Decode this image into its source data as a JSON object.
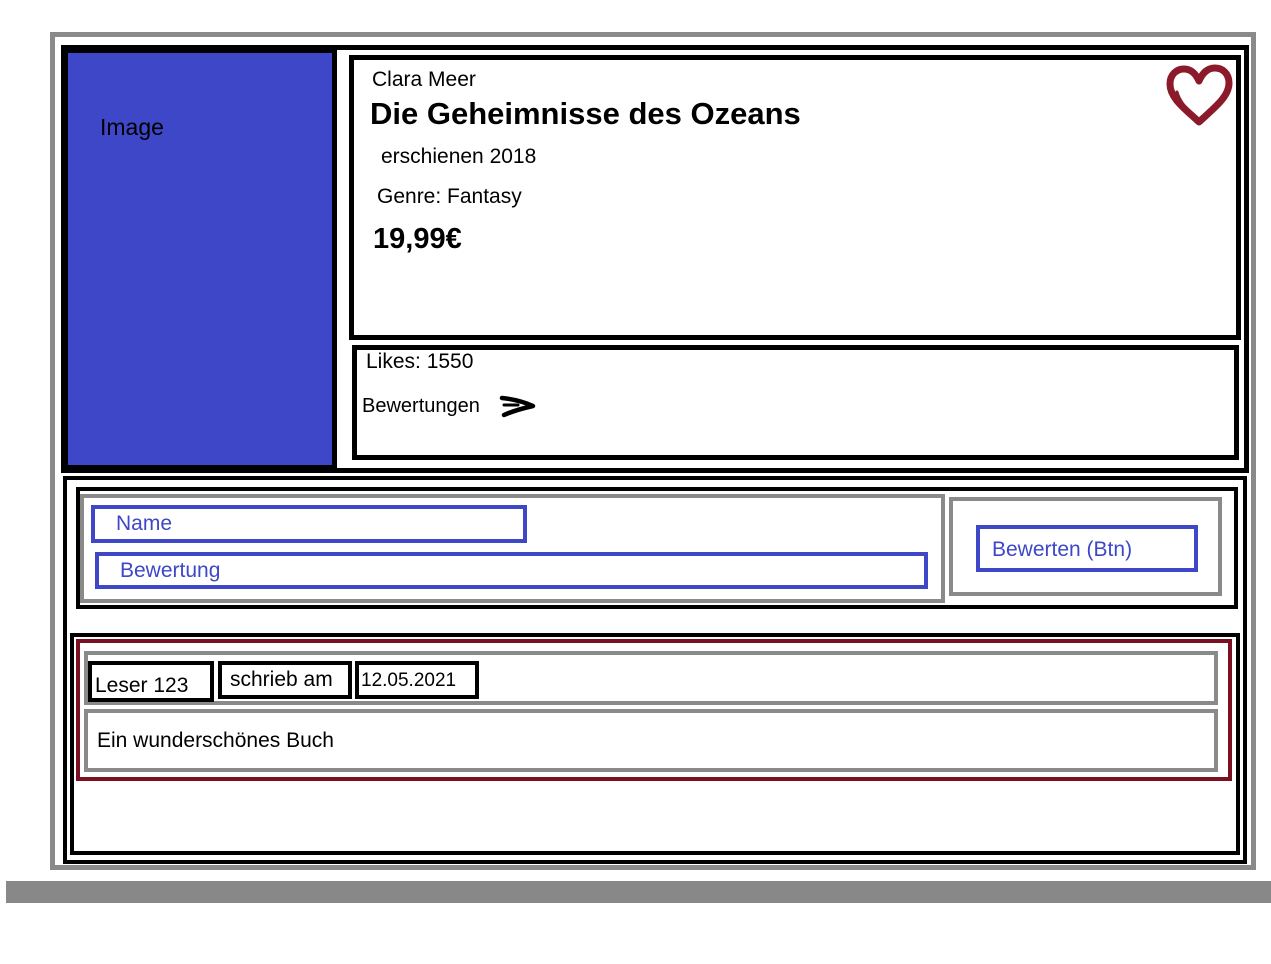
{
  "image_placeholder": "Image",
  "book": {
    "author": "Clara Meer",
    "title": "Die Geheimnisse des Ozeans",
    "published": "erschienen 2018",
    "genre": "Genre: Fantasy",
    "price": "19,99€"
  },
  "stats": {
    "likes": "Likes: 1550",
    "reviews_link": "Bewertungen"
  },
  "form": {
    "name_placeholder": "Name",
    "rating_placeholder": "Bewertung",
    "submit_label": "Bewerten (Btn)"
  },
  "review": {
    "reader": "Leser 123",
    "wrote": "schrieb am",
    "date": "12.05.2021",
    "text": "Ein wunderschönes Buch"
  },
  "colors": {
    "image_fill": "#3d47c7",
    "field_border": "#3d47c7",
    "heart": "#8b1a2b",
    "review_border": "#7a1022",
    "gray_border": "#8a8a8a"
  },
  "icons": {
    "like": "heart-icon",
    "reviews": "arrow-right-icon"
  }
}
